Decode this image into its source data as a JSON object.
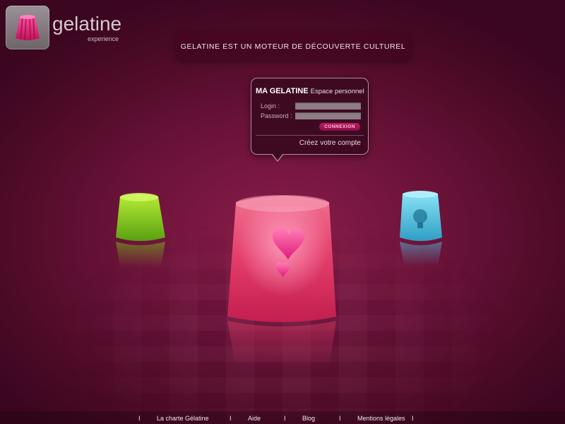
{
  "brand": {
    "name": "gelatine",
    "sub": "experience"
  },
  "tagline": "GELATINE EST  UN MOTEUR DE DÉCOUVERTE CULTUREL",
  "login": {
    "title_bold": "MA GELATINE",
    "title_rest": "Espace personnel",
    "login_label": "Login :",
    "password_label": "Password :",
    "login_value": "",
    "password_value": "",
    "submit_label": "CONNEXION",
    "create_account": "Créez votre compte"
  },
  "footer": {
    "separator": "I",
    "links": [
      "La charte Gélatine",
      "Aide",
      "Blog",
      "Mentions légales"
    ]
  },
  "colors": {
    "background": "#6a1238",
    "accent": "#c21a66",
    "jelly_green": "#8fd01a",
    "jelly_pink": "#e23a6c",
    "jelly_blue": "#4fc6e2"
  },
  "icons": {
    "logo": "jelly-logo-icon",
    "green": "green-jelly-icon",
    "pink": "heart-jelly-icon",
    "blue": "lightbulb-jelly-icon"
  }
}
